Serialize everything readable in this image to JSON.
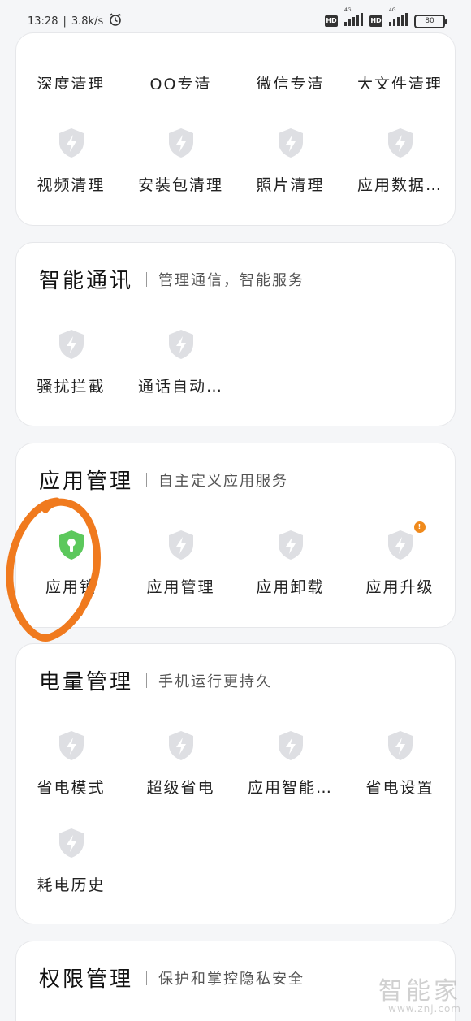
{
  "status_bar": {
    "time": "13:28",
    "net_speed": "3.8k/s",
    "hd_label": "HD",
    "net_type": "4G",
    "battery": "80"
  },
  "cards": {
    "clean": {
      "row1": [
        "深度清理",
        "QQ专清",
        "微信专清",
        "大文件清理"
      ],
      "row2": [
        "视频清理",
        "安装包清理",
        "照片清理",
        "应用数据…"
      ]
    },
    "comm": {
      "title": "智能通讯",
      "subtitle": "管理通信，智能服务",
      "items": [
        "骚扰拦截",
        "通话自动…"
      ]
    },
    "app": {
      "title": "应用管理",
      "subtitle": "自主定义应用服务",
      "items": [
        "应用锁",
        "应用管理",
        "应用卸载",
        "应用升级"
      ],
      "badge": "!"
    },
    "power": {
      "title": "电量管理",
      "subtitle": "手机运行更持久",
      "row1": [
        "省电模式",
        "超级省电",
        "应用智能…",
        "省电设置"
      ],
      "row2": [
        "耗电历史"
      ]
    },
    "perm": {
      "title": "权限管理",
      "subtitle": "保护和掌控隐私安全"
    }
  },
  "watermark": {
    "name": "智能家",
    "url": "www.znj.com"
  },
  "colors": {
    "icon_gray": "#dedfe3",
    "icon_green": "#5cc85c",
    "badge_orange": "#f08a1c",
    "annotation_orange": "#f07a1e"
  }
}
